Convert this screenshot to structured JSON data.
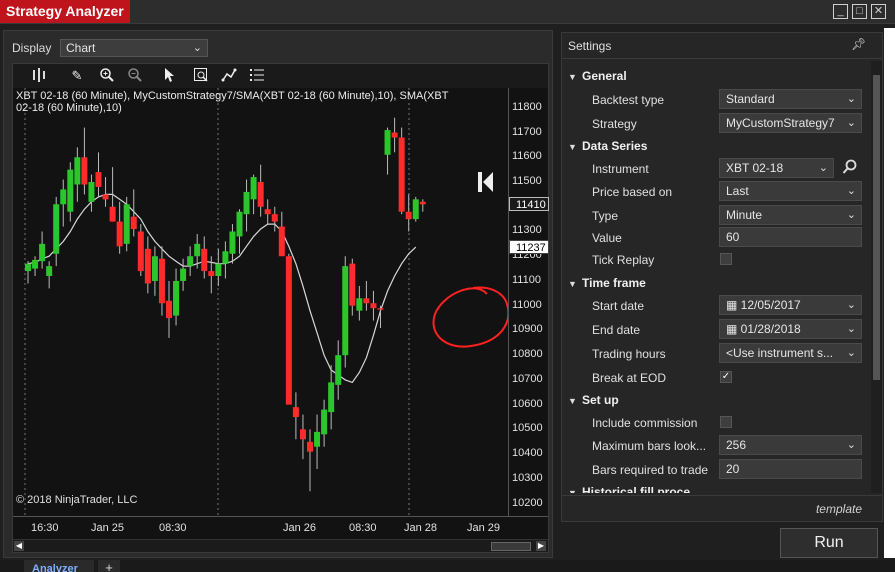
{
  "window": {
    "title": "Strategy Analyzer"
  },
  "display": {
    "label": "Display",
    "value": "Chart"
  },
  "chart": {
    "series_label": "XBT 02-18 (60 Minute), MyCustomStrategy7/SMA(XBT 02-18 (60 Minute),10), SMA(XBT 02-18 (60 Minute),10)",
    "copyright": "© 2018 NinjaTrader, LLC",
    "last_price_tag": "11410",
    "sma_price_tag": "11237",
    "y_ticks": [
      "11800",
      "11700",
      "11600",
      "11500",
      "11400",
      "11300",
      "11200",
      "11100",
      "11000",
      "10900",
      "10800",
      "10700",
      "10600",
      "10500",
      "10400",
      "10300",
      "10200"
    ],
    "x_ticks": [
      "16:30",
      "Jan 25",
      "08:30",
      "Jan 26",
      "08:30",
      "Jan 28",
      "Jan 29"
    ]
  },
  "chart_data": {
    "type": "candlestick",
    "ylim": [
      10150,
      11880
    ],
    "candles": [
      {
        "o": 11140,
        "h": 11180,
        "l": 11090,
        "c": 11170
      },
      {
        "o": 11150,
        "h": 11200,
        "l": 11120,
        "c": 11185
      },
      {
        "o": 11180,
        "h": 11300,
        "l": 11150,
        "c": 11250
      },
      {
        "o": 11120,
        "h": 11180,
        "l": 11070,
        "c": 11160
      },
      {
        "o": 11210,
        "h": 11440,
        "l": 11160,
        "c": 11410
      },
      {
        "o": 11410,
        "h": 11510,
        "l": 11320,
        "c": 11470
      },
      {
        "o": 11380,
        "h": 11580,
        "l": 11340,
        "c": 11550
      },
      {
        "o": 11490,
        "h": 11640,
        "l": 11420,
        "c": 11600
      },
      {
        "o": 11600,
        "h": 11720,
        "l": 11450,
        "c": 11490
      },
      {
        "o": 11420,
        "h": 11530,
        "l": 11380,
        "c": 11500
      },
      {
        "o": 11540,
        "h": 11620,
        "l": 11440,
        "c": 11480
      },
      {
        "o": 11450,
        "h": 11520,
        "l": 11400,
        "c": 11430
      },
      {
        "o": 11400,
        "h": 11560,
        "l": 11340,
        "c": 11340
      },
      {
        "o": 11340,
        "h": 11420,
        "l": 11210,
        "c": 11240
      },
      {
        "o": 11250,
        "h": 11440,
        "l": 11220,
        "c": 11410
      },
      {
        "o": 11360,
        "h": 11470,
        "l": 11280,
        "c": 11310
      },
      {
        "o": 11300,
        "h": 11330,
        "l": 11120,
        "c": 11140
      },
      {
        "o": 11230,
        "h": 11280,
        "l": 11050,
        "c": 11090
      },
      {
        "o": 11100,
        "h": 11240,
        "l": 11040,
        "c": 11200
      },
      {
        "o": 11190,
        "h": 11240,
        "l": 10960,
        "c": 11010
      },
      {
        "o": 11020,
        "h": 11100,
        "l": 10870,
        "c": 10950
      },
      {
        "o": 10960,
        "h": 11150,
        "l": 10920,
        "c": 11100
      },
      {
        "o": 11100,
        "h": 11190,
        "l": 11060,
        "c": 11150
      },
      {
        "o": 11160,
        "h": 11240,
        "l": 11120,
        "c": 11200
      },
      {
        "o": 11200,
        "h": 11290,
        "l": 11150,
        "c": 11250
      },
      {
        "o": 11230,
        "h": 11280,
        "l": 11110,
        "c": 11140
      },
      {
        "o": 11140,
        "h": 11200,
        "l": 11050,
        "c": 11120
      },
      {
        "o": 11120,
        "h": 11230,
        "l": 11080,
        "c": 11170
      },
      {
        "o": 11170,
        "h": 11260,
        "l": 11110,
        "c": 11220
      },
      {
        "o": 11210,
        "h": 11330,
        "l": 11170,
        "c": 11300
      },
      {
        "o": 11280,
        "h": 11390,
        "l": 11210,
        "c": 11380
      },
      {
        "o": 11370,
        "h": 11510,
        "l": 11300,
        "c": 11460
      },
      {
        "o": 11430,
        "h": 11530,
        "l": 11370,
        "c": 11520
      },
      {
        "o": 11500,
        "h": 11570,
        "l": 11360,
        "c": 11400
      },
      {
        "o": 11390,
        "h": 11430,
        "l": 11330,
        "c": 11370
      },
      {
        "o": 11370,
        "h": 11400,
        "l": 11300,
        "c": 11340
      },
      {
        "o": 11320,
        "h": 11380,
        "l": 11230,
        "c": 11200
      },
      {
        "o": 11200,
        "h": 11210,
        "l": 10860,
        "c": 10600
      },
      {
        "o": 10590,
        "h": 10650,
        "l": 10460,
        "c": 10550
      },
      {
        "o": 10500,
        "h": 10560,
        "l": 10380,
        "c": 10460
      },
      {
        "o": 10450,
        "h": 10500,
        "l": 10250,
        "c": 10410
      },
      {
        "o": 10430,
        "h": 10560,
        "l": 10340,
        "c": 10490
      },
      {
        "o": 10480,
        "h": 10620,
        "l": 10430,
        "c": 10580
      },
      {
        "o": 10570,
        "h": 10760,
        "l": 10500,
        "c": 10690
      },
      {
        "o": 10680,
        "h": 10860,
        "l": 10620,
        "c": 10800
      },
      {
        "o": 10800,
        "h": 11200,
        "l": 10750,
        "c": 11160
      },
      {
        "o": 11170,
        "h": 11190,
        "l": 10960,
        "c": 11000
      },
      {
        "o": 10980,
        "h": 11080,
        "l": 10940,
        "c": 11030
      },
      {
        "o": 11030,
        "h": 11100,
        "l": 10980,
        "c": 11010
      },
      {
        "o": 11010,
        "h": 11060,
        "l": 10940,
        "c": 10990
      },
      {
        "o": 10990,
        "h": 11000,
        "l": 10910,
        "c": 10985
      },
      {
        "o": 11610,
        "h": 11720,
        "l": 11530,
        "c": 11710
      },
      {
        "o": 11700,
        "h": 11760,
        "l": 11620,
        "c": 11680
      },
      {
        "o": 11680,
        "h": 11720,
        "l": 11370,
        "c": 11380
      },
      {
        "o": 11380,
        "h": 11450,
        "l": 11300,
        "c": 11350
      },
      {
        "o": 11350,
        "h": 11440,
        "l": 11340,
        "c": 11430
      },
      {
        "o": 11420,
        "h": 11430,
        "l": 11380,
        "c": 11410
      }
    ],
    "sma": [
      11170,
      11175,
      11190,
      11200,
      11230,
      11260,
      11300,
      11350,
      11390,
      11420,
      11440,
      11450,
      11450,
      11430,
      11410,
      11380,
      11350,
      11300,
      11260,
      11230,
      11200,
      11180,
      11160,
      11160,
      11170,
      11180,
      11175,
      11170,
      11170,
      11180,
      11200,
      11240,
      11280,
      11310,
      11330,
      11330,
      11300,
      11240,
      11170,
      11080,
      10980,
      10890,
      10800,
      10740,
      10720,
      10700,
      10690,
      10730,
      10790,
      10880,
      10980,
      11060,
      11120,
      11170,
      11210,
      11237
    ]
  },
  "settings": {
    "title": "Settings",
    "sections": [
      {
        "name": "General"
      },
      {
        "name": "Data Series"
      },
      {
        "name": "Time frame"
      },
      {
        "name": "Set up"
      },
      {
        "name": "Historical fill proce"
      }
    ],
    "props": {
      "backtest_type": {
        "label": "Backtest type",
        "value": "Standard"
      },
      "strategy": {
        "label": "Strategy",
        "value": "MyCustomStrategy7"
      },
      "instrument": {
        "label": "Instrument",
        "value": "XBT 02-18"
      },
      "price_based_on": {
        "label": "Price based on",
        "value": "Last"
      },
      "type": {
        "label": "Type",
        "value": "Minute"
      },
      "value": {
        "label": "Value",
        "value": "60"
      },
      "tick_replay": {
        "label": "Tick Replay",
        "checked": false
      },
      "start_date": {
        "label": "Start date",
        "value": "12/05/2017"
      },
      "end_date": {
        "label": "End date",
        "value": "01/28/2018"
      },
      "trading_hours": {
        "label": "Trading hours",
        "value": "<Use instrument s..."
      },
      "break_at_eod": {
        "label": "Break at EOD",
        "checked": true
      },
      "include_commission": {
        "label": "Include commission",
        "checked": false
      },
      "max_bars": {
        "label": "Maximum bars look...",
        "value": "256"
      },
      "bars_required": {
        "label": "Bars required to trade",
        "value": "20"
      }
    },
    "template_label": "template"
  },
  "run_label": "Run",
  "tabs": {
    "analyzer": "Analyzer",
    "add": "+"
  }
}
